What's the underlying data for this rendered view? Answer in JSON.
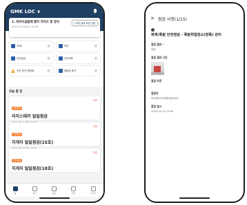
{
  "left": {
    "header": {
      "title": "GMK LOC ∨"
    },
    "notice": {
      "title": "1. 처지수급법에 평가 가이드 및 양식",
      "date": "2023-10-04(수) 10:30",
      "button_label": "1개의 결재 요청 있음"
    },
    "menu": [
      {
        "label": "TBM",
        "count": "2",
        "icon": "clipboard-icon"
      },
      {
        "label": "작업",
        "count": "0",
        "icon": "list-icon"
      },
      {
        "label": "안전점검",
        "count": "0",
        "icon": "check-icon"
      },
      {
        "label": "안전교육",
        "count": "0",
        "icon": "education-icon"
      },
      {
        "label": "안전 보건 협의회",
        "count": "0",
        "icon": "warning-icon"
      },
      {
        "label": "위험성 평가",
        "count": "0",
        "icon": "document-icon"
      }
    ],
    "today": {
      "title": "오늘 할 일",
      "tasks": [
        {
          "tag": "안전점검",
          "status": "지연",
          "title": "리치스태커 일일점검",
          "date": "2024-06-11(화) 07:00",
          "meta_left": "정비 / 일반(1)",
          "meta_right": "점검자 (고무성 외 1명)"
        },
        {
          "tag": "안전점검",
          "status": "지연",
          "title": "지게차 일일점검(15호)",
          "date": "2024-06-11(화) 07:00",
          "meta_left": "정비 / 일반(1)",
          "meta_right": "점검자 (강동훈/철차 외 3명)"
        },
        {
          "tag": "안전점검",
          "status": "지연",
          "title": "지게차 일일점검(18호)",
          "date": "",
          "meta_left": "",
          "meta_right": ""
        }
      ]
    },
    "tabs": [
      {
        "label": "홈",
        "active": true,
        "icon": "home-icon"
      },
      {
        "label": "평가",
        "active": false,
        "icon": "clipboard-icon"
      },
      {
        "label": "점검",
        "active": false,
        "icon": "check-icon"
      },
      {
        "label": "위험",
        "active": false,
        "icon": "warning-icon"
      },
      {
        "label": "더보기",
        "active": false,
        "icon": "grid-icon"
      }
    ]
  },
  "right": {
    "title": "점검 사항(1/15)",
    "heading": "화재/폭발 안전점검 - 폭발위험장소(방폭) 관리",
    "fields": {
      "result_label": "점검 결과",
      "result_required": "*",
      "result_value": "양호",
      "photo_label": "점검 결과 사진",
      "opinion_label": "점검 의견",
      "opinion_value": "-",
      "inspector_label": "점검자",
      "inspector_value": "허지훈(자사직원/삼성SDS",
      "date_label": "점검 일시",
      "date_value": "2023-03-15 15:00"
    }
  },
  "colors": {
    "header": "#1f3f63",
    "tag": "#f3802f",
    "delay": "#e04b3a"
  }
}
